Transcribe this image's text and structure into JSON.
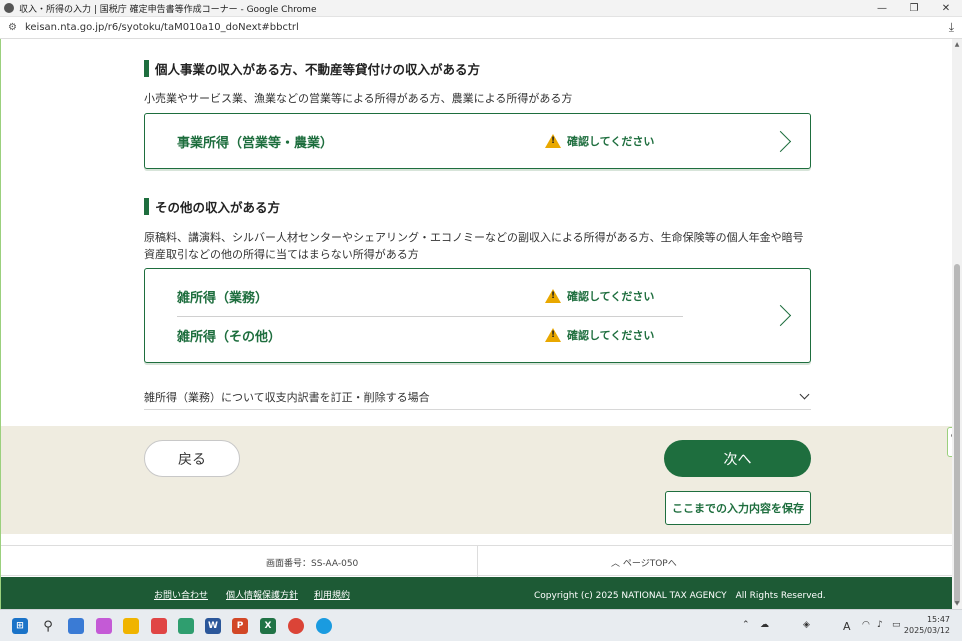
{
  "window": {
    "title": "収入・所得の入力 | 国税庁 確定申告書等作成コーナー - Google Chrome",
    "minimize": "—",
    "restore": "❐",
    "close": "✕"
  },
  "address": {
    "url": "keisan.nta.go.jp/r6/syotoku/taM010a10_doNext#bbctrl"
  },
  "sections": {
    "business": {
      "heading": "個人事業の収入がある方、不動産等貸付けの収入がある方",
      "description": "小売業やサービス業、漁業などの営業等による所得がある方、農業による所得がある方",
      "items": [
        {
          "label": "事業所得（営業等・農業）",
          "status": "確認してください"
        }
      ]
    },
    "other": {
      "heading": "その他の収入がある方",
      "description": "原稿料、講演料、シルバー人材センターやシェアリング・エコノミーなどの副収入による所得がある方、生命保険等の個人年金や暗号資産取引などの他の所得に当てはまらない所得がある方",
      "items": [
        {
          "label": "雑所得（業務）",
          "status": "確認してください"
        },
        {
          "label": "雑所得（その他）",
          "status": "確認してください"
        }
      ]
    }
  },
  "accordion": {
    "label": "雑所得（業務）について収支内訳書を訂正・削除する場合"
  },
  "actions": {
    "back": "戻る",
    "next": "次へ",
    "save": "ここまでの入力内容を保存"
  },
  "info": {
    "screen_number": "画面番号：SS-AA-050",
    "page_top": "ページTOPへ"
  },
  "footer": {
    "links": [
      "お問い合わせ",
      "個人情報保護方針",
      "利用規約"
    ],
    "copyright": "Copyright (c) 2025 NATIONAL TAX AGENCY　All Rights Reserved."
  },
  "taskbar": {
    "time": "15:47",
    "date": "2025/03/12",
    "ime": "A"
  },
  "colors": {
    "brand_green": "#1e6e3e",
    "footer_green": "#1d5a35",
    "action_bg": "#efece0",
    "warning": "#e9a800"
  }
}
